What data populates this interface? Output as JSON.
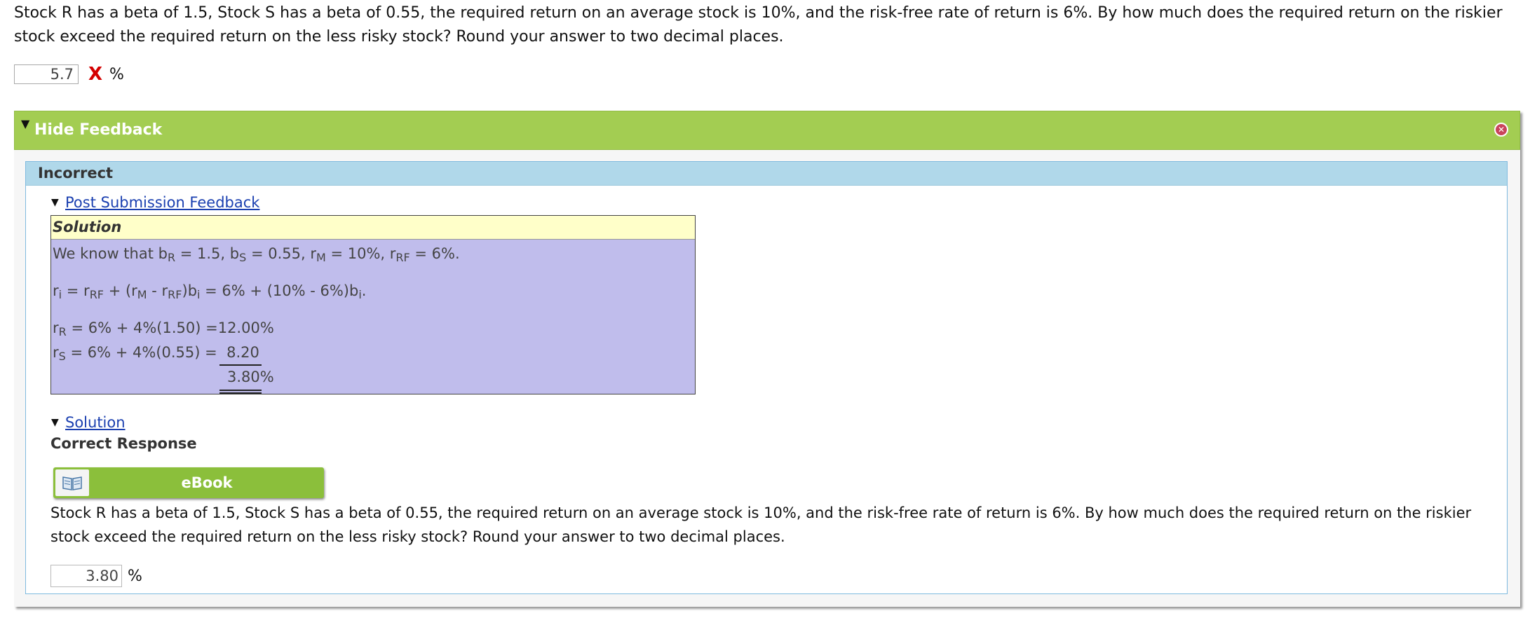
{
  "question": {
    "text": "Stock R has a beta of 1.5, Stock S has a beta of 0.55, the required return on an average stock is 10%, and the risk-free rate of return is 6%. By how much does the required return on the riskier stock exceed the required return on the less risky stock? Round your answer to two decimal places.",
    "answer_value": "5.7",
    "wrong_mark": "X",
    "unit": "%"
  },
  "feedback": {
    "toggle_label": "Hide Feedback",
    "status": "Incorrect",
    "post_submission_link": "Post Submission Feedback",
    "solution_header": "Solution",
    "lines": {
      "l1_a": "We know that b",
      "l1_b": "R",
      "l1_c": " = 1.5, b",
      "l1_d": "S",
      "l1_e": " = 0.55, r",
      "l1_f": "M",
      "l1_g": " = 10%, r",
      "l1_h": "RF",
      "l1_i": " = 6%.",
      "l2_a": "r",
      "l2_b": "i",
      "l2_c": " = r",
      "l2_d": "RF",
      "l2_e": " + (r",
      "l2_f": "M",
      "l2_g": " - r",
      "l2_h": "RF",
      "l2_i": ")b",
      "l2_j": "i",
      "l2_k": " = 6% + (10% - 6%)b",
      "l2_l": "i",
      "l2_m": ".",
      "l3_a": "r",
      "l3_b": "R",
      "l3_c": " = 6% + 4%(1.50) =12.00%",
      "l4_a": "r",
      "l4_b": "S",
      "l4_c": " = 6% + 4%(0.55) =  8.20",
      "l5": "3.80%"
    },
    "solution_link": "Solution",
    "correct_response_label": "Correct Response",
    "ebook_label": "eBook",
    "question_repeat": "Stock R has a beta of 1.5, Stock S has a beta of 0.55, the required return on an average stock is 10%, and the risk-free rate of return is 6%. By how much does the required return on the riskier stock exceed the required return on the less risky stock? Round your answer to two decimal places.",
    "correct_value": "3.80",
    "unit": "%"
  },
  "colors": {
    "feedback_header": "#a3cd52",
    "incorrect_bar": "#b0d8ea",
    "solution_body": "#c0bdec",
    "solution_header": "#ffffc9",
    "ebook_button": "#8bbf3b",
    "wrong_mark": "#d40000",
    "link": "#1a3fb0"
  },
  "icons": [
    "disclosure-triangle-icon",
    "close-icon",
    "book-icon"
  ]
}
